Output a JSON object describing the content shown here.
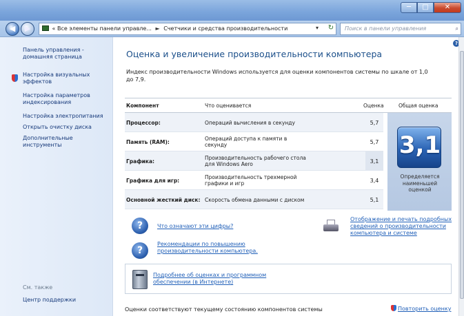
{
  "window": {
    "min": "─",
    "max": "□",
    "close": "✕"
  },
  "address": {
    "back": "◀",
    "forward": "▶",
    "prefix": "«",
    "crumbs": [
      "Все элементы панели управле...",
      "Счетчики и средства производительности"
    ],
    "separator": "►",
    "dropdown": "▾",
    "refresh": "↻",
    "search_placeholder": "Поиск в панели управления",
    "search_icon": "⌕"
  },
  "sidebar": {
    "home": "Панель управления - домашняя страница",
    "items": [
      "Настройка визуальных эффектов",
      "Настройка параметров индексирования",
      "Настройка электропитания",
      "Открыть очистку диска",
      "Дополнительные инструменты"
    ],
    "see_also": "См. также",
    "support": "Центр поддержки"
  },
  "main": {
    "help_icon": "?",
    "title": "Оценка и увеличение производительности компьютера",
    "description": "Индекс производительности Windows используется для оценки компонентов системы по шкале от 1,0 до 7,9.",
    "table": {
      "headers": [
        "Компонент",
        "Что оценивается",
        "Оценка",
        "Общая оценка"
      ],
      "rows": [
        {
          "component": "Процессор:",
          "what": "Операций вычисления в секунду",
          "score": "5,7"
        },
        {
          "component": "Память (RAM):",
          "what": "Операций доступа к памяти в секунду",
          "score": "5,7"
        },
        {
          "component": "Графика:",
          "what": "Производительность рабочего стола для Windows Aero",
          "score": "3,1"
        },
        {
          "component": "Графика для игр:",
          "what": "Производительность трехмерной графики и игр",
          "score": "3,4"
        },
        {
          "component": "Основной жесткий диск:",
          "what": "Скорость обмена данными с диском",
          "score": "5,1"
        }
      ],
      "overall": "3,1",
      "overall_caption": "Определяется наименьшей оценкой"
    },
    "links": {
      "what_numbers": "Что означают эти цифры?",
      "tips": "Рекомендации по повышению производительности компьютера.",
      "print": "Отображение и печать подробных сведений о производительности компьютера и системе",
      "online": "Подробнее об оценках и программном обеспечении (в Интернете)"
    },
    "footer": "Оценки соответствуют текущему состоянию компонентов системы",
    "rerun": "Повторить оценку"
  },
  "colors": {
    "accent": "#1b4f8a",
    "link": "#1f5fb8",
    "badge": "#2b64b5"
  }
}
